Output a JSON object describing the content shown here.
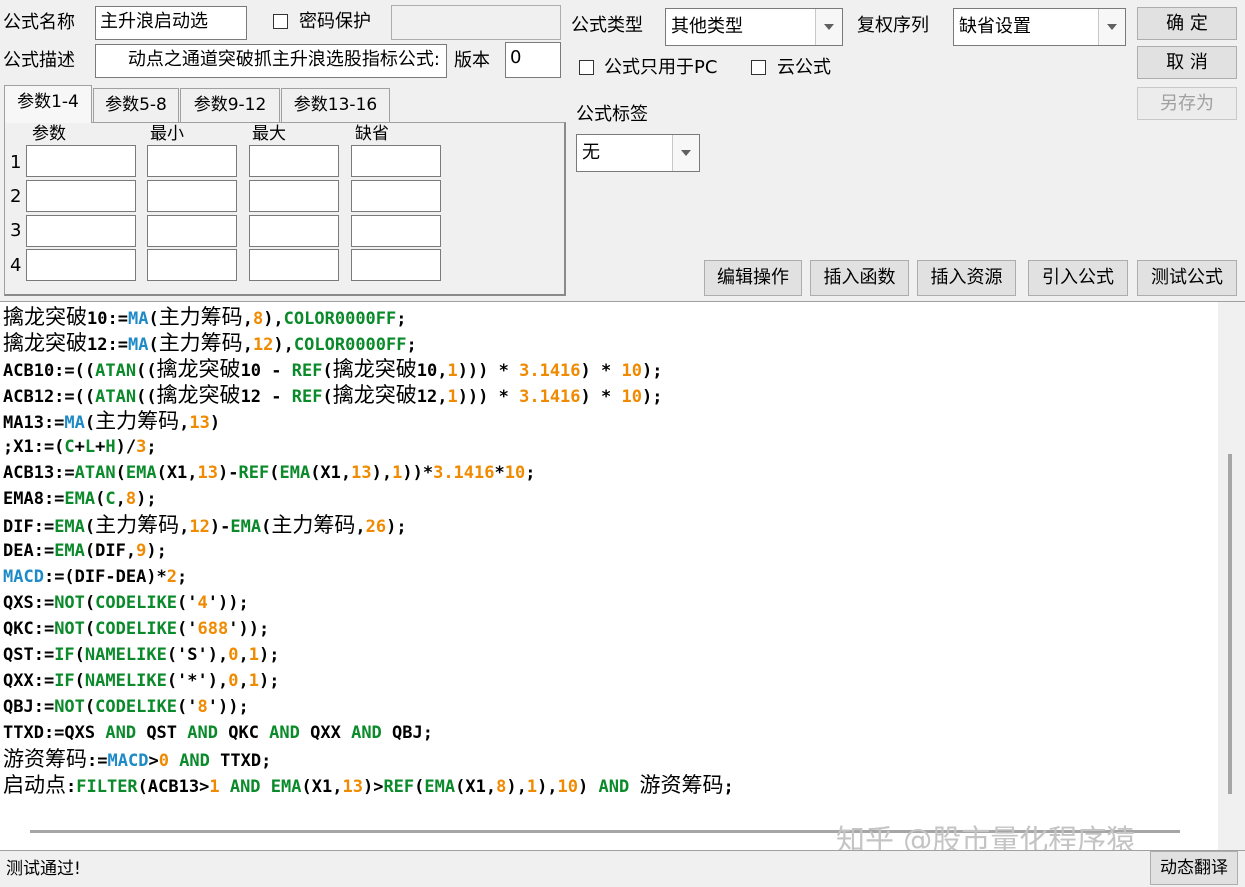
{
  "header": {
    "name_label": "公式名称",
    "name_value": "主升浪启动选",
    "password_label": "密码保护",
    "password_value": "",
    "desc_label": "公式描述",
    "desc_value": "动点之通道突破抓主升浪选股指标公式:",
    "version_label": "版本",
    "version_value": "0",
    "type_label": "公式类型",
    "type_value": "其他类型",
    "rights_label": "复权序列",
    "rights_value": "缺省设置",
    "pc_only_label": "公式只用于PC",
    "cloud_label": "云公式",
    "tag_label": "公式标签",
    "tag_value": "无"
  },
  "buttons": {
    "ok": "确  定",
    "cancel": "取  消",
    "save_as": "另存为",
    "edit": "编辑操作",
    "insert_func": "插入函数",
    "insert_res": "插入资源",
    "import": "引入公式",
    "test": "测试公式",
    "translate": "动态翻译"
  },
  "params": {
    "tabs": [
      "参数1-4",
      "参数5-8",
      "参数9-12",
      "参数13-16"
    ],
    "columns": [
      "参数",
      "最小",
      "最大",
      "缺省"
    ],
    "rows": [
      "1",
      "2",
      "3",
      "4"
    ]
  },
  "code_lines": [
    [
      {
        "t": "擒龙突破",
        "c": "cj"
      },
      {
        "t": "10:="
      },
      {
        "t": "MA",
        "c": "b"
      },
      {
        "t": "("
      },
      {
        "t": "主力筹码",
        "c": "cj"
      },
      {
        "t": ","
      },
      {
        "t": "8",
        "c": "n"
      },
      {
        "t": "),"
      },
      {
        "t": "COLOR0000FF",
        "c": "c"
      },
      {
        "t": ";"
      }
    ],
    [
      {
        "t": "擒龙突破",
        "c": "cj"
      },
      {
        "t": "12:="
      },
      {
        "t": "MA",
        "c": "b"
      },
      {
        "t": "("
      },
      {
        "t": "主力筹码",
        "c": "cj"
      },
      {
        "t": ","
      },
      {
        "t": "12",
        "c": "n"
      },
      {
        "t": "),"
      },
      {
        "t": "COLOR0000FF",
        "c": "c"
      },
      {
        "t": ";"
      }
    ],
    [
      {
        "t": "ACB10:=(("
      },
      {
        "t": "ATAN",
        "c": "f"
      },
      {
        "t": "(("
      },
      {
        "t": "擒龙突破",
        "c": "cj"
      },
      {
        "t": "10 - "
      },
      {
        "t": "REF",
        "c": "f"
      },
      {
        "t": "("
      },
      {
        "t": "擒龙突破",
        "c": "cj"
      },
      {
        "t": "10,"
      },
      {
        "t": "1",
        "c": "n"
      },
      {
        "t": "))) * "
      },
      {
        "t": "3.1416",
        "c": "n"
      },
      {
        "t": ") * "
      },
      {
        "t": "10",
        "c": "n"
      },
      {
        "t": ");"
      }
    ],
    [
      {
        "t": "ACB12:=(("
      },
      {
        "t": "ATAN",
        "c": "f"
      },
      {
        "t": "(("
      },
      {
        "t": "擒龙突破",
        "c": "cj"
      },
      {
        "t": "12 - "
      },
      {
        "t": "REF",
        "c": "f"
      },
      {
        "t": "("
      },
      {
        "t": "擒龙突破",
        "c": "cj"
      },
      {
        "t": "12,"
      },
      {
        "t": "1",
        "c": "n"
      },
      {
        "t": "))) * "
      },
      {
        "t": "3.1416",
        "c": "n"
      },
      {
        "t": ") * "
      },
      {
        "t": "10",
        "c": "n"
      },
      {
        "t": ");"
      }
    ],
    [
      {
        "t": "MA13:="
      },
      {
        "t": "MA",
        "c": "b"
      },
      {
        "t": "("
      },
      {
        "t": "主力筹码",
        "c": "cj"
      },
      {
        "t": ","
      },
      {
        "t": "13",
        "c": "n"
      },
      {
        "t": ")"
      }
    ],
    [
      {
        "t": ";X1:=("
      },
      {
        "t": "C",
        "c": "f"
      },
      {
        "t": "+"
      },
      {
        "t": "L",
        "c": "f"
      },
      {
        "t": "+"
      },
      {
        "t": "H",
        "c": "f"
      },
      {
        "t": ")/"
      },
      {
        "t": "3",
        "c": "n"
      },
      {
        "t": ";"
      }
    ],
    [
      {
        "t": "ACB13:="
      },
      {
        "t": "ATAN",
        "c": "f"
      },
      {
        "t": "("
      },
      {
        "t": "EMA",
        "c": "f"
      },
      {
        "t": "(X1,"
      },
      {
        "t": "13",
        "c": "n"
      },
      {
        "t": ")-"
      },
      {
        "t": "REF",
        "c": "f"
      },
      {
        "t": "("
      },
      {
        "t": "EMA",
        "c": "f"
      },
      {
        "t": "(X1,"
      },
      {
        "t": "13",
        "c": "n"
      },
      {
        "t": "),"
      },
      {
        "t": "1",
        "c": "n"
      },
      {
        "t": "))*"
      },
      {
        "t": "3.1416",
        "c": "n"
      },
      {
        "t": "*"
      },
      {
        "t": "10",
        "c": "n"
      },
      {
        "t": ";"
      }
    ],
    [
      {
        "t": "EMA8:="
      },
      {
        "t": "EMA",
        "c": "f"
      },
      {
        "t": "("
      },
      {
        "t": "C",
        "c": "f"
      },
      {
        "t": ","
      },
      {
        "t": "8",
        "c": "n"
      },
      {
        "t": ");"
      }
    ],
    [
      {
        "t": "DIF:="
      },
      {
        "t": "EMA",
        "c": "f"
      },
      {
        "t": "("
      },
      {
        "t": "主力筹码",
        "c": "cj"
      },
      {
        "t": ","
      },
      {
        "t": "12",
        "c": "n"
      },
      {
        "t": ")-"
      },
      {
        "t": "EMA",
        "c": "f"
      },
      {
        "t": "("
      },
      {
        "t": "主力筹码",
        "c": "cj"
      },
      {
        "t": ","
      },
      {
        "t": "26",
        "c": "n"
      },
      {
        "t": ");"
      }
    ],
    [
      {
        "t": "DEA:="
      },
      {
        "t": "EMA",
        "c": "f"
      },
      {
        "t": "(DIF,"
      },
      {
        "t": "9",
        "c": "n"
      },
      {
        "t": ");"
      }
    ],
    [
      {
        "t": "MACD",
        "c": "b"
      },
      {
        "t": ":=(DIF-DEA)*"
      },
      {
        "t": "2",
        "c": "n"
      },
      {
        "t": ";"
      }
    ],
    [
      {
        "t": "QXS:="
      },
      {
        "t": "NOT",
        "c": "f"
      },
      {
        "t": "("
      },
      {
        "t": "CODELIKE",
        "c": "f"
      },
      {
        "t": "('"
      },
      {
        "t": "4",
        "c": "n"
      },
      {
        "t": "'));"
      }
    ],
    [
      {
        "t": "QKC:="
      },
      {
        "t": "NOT",
        "c": "f"
      },
      {
        "t": "("
      },
      {
        "t": "CODELIKE",
        "c": "f"
      },
      {
        "t": "('"
      },
      {
        "t": "688",
        "c": "n"
      },
      {
        "t": "'));"
      }
    ],
    [
      {
        "t": "QST:="
      },
      {
        "t": "IF",
        "c": "f"
      },
      {
        "t": "("
      },
      {
        "t": "NAMELIKE",
        "c": "f"
      },
      {
        "t": "('S'),"
      },
      {
        "t": "0",
        "c": "n"
      },
      {
        "t": ","
      },
      {
        "t": "1",
        "c": "n"
      },
      {
        "t": ");"
      }
    ],
    [
      {
        "t": "QXX:="
      },
      {
        "t": "IF",
        "c": "f"
      },
      {
        "t": "("
      },
      {
        "t": "NAMELIKE",
        "c": "f"
      },
      {
        "t": "('*'),"
      },
      {
        "t": "0",
        "c": "n"
      },
      {
        "t": ","
      },
      {
        "t": "1",
        "c": "n"
      },
      {
        "t": ");"
      }
    ],
    [
      {
        "t": "QBJ:="
      },
      {
        "t": "NOT",
        "c": "f"
      },
      {
        "t": "("
      },
      {
        "t": "CODELIKE",
        "c": "f"
      },
      {
        "t": "('"
      },
      {
        "t": "8",
        "c": "n"
      },
      {
        "t": "'));"
      }
    ],
    [
      {
        "t": "TTXD:=QXS "
      },
      {
        "t": "AND",
        "c": "f"
      },
      {
        "t": " QST "
      },
      {
        "t": "AND",
        "c": "f"
      },
      {
        "t": " QKC "
      },
      {
        "t": "AND",
        "c": "f"
      },
      {
        "t": " QXX "
      },
      {
        "t": "AND",
        "c": "f"
      },
      {
        "t": " QBJ;"
      }
    ],
    [
      {
        "t": "游资筹码",
        "c": "cj"
      },
      {
        "t": ":="
      },
      {
        "t": "MACD",
        "c": "b"
      },
      {
        "t": ">"
      },
      {
        "t": "0",
        "c": "n"
      },
      {
        "t": " "
      },
      {
        "t": "AND",
        "c": "f"
      },
      {
        "t": " TTXD;"
      }
    ],
    [
      {
        "t": "启动点",
        "c": "cj"
      },
      {
        "t": ":"
      },
      {
        "t": "FILTER",
        "c": "f"
      },
      {
        "t": "(ACB13>"
      },
      {
        "t": "1",
        "c": "n"
      },
      {
        "t": " "
      },
      {
        "t": "AND",
        "c": "f"
      },
      {
        "t": " "
      },
      {
        "t": "EMA",
        "c": "f"
      },
      {
        "t": "(X1,"
      },
      {
        "t": "13",
        "c": "n"
      },
      {
        "t": ")>"
      },
      {
        "t": "REF",
        "c": "f"
      },
      {
        "t": "("
      },
      {
        "t": "EMA",
        "c": "f"
      },
      {
        "t": "(X1,"
      },
      {
        "t": "8",
        "c": "n"
      },
      {
        "t": "),"
      },
      {
        "t": "1",
        "c": "n"
      },
      {
        "t": "),"
      },
      {
        "t": "10",
        "c": "n"
      },
      {
        "t": ") "
      },
      {
        "t": "AND",
        "c": "f"
      },
      {
        "t": " "
      },
      {
        "t": "游资筹码",
        "c": "cj"
      },
      {
        "t": ";"
      }
    ]
  ],
  "status_text": "测试通过!",
  "watermark": "知乎 @股市量化程序猿",
  "colors": {
    "function": "#0a8a2a",
    "number": "#f08a00",
    "builtin": "#1e8ac8"
  }
}
